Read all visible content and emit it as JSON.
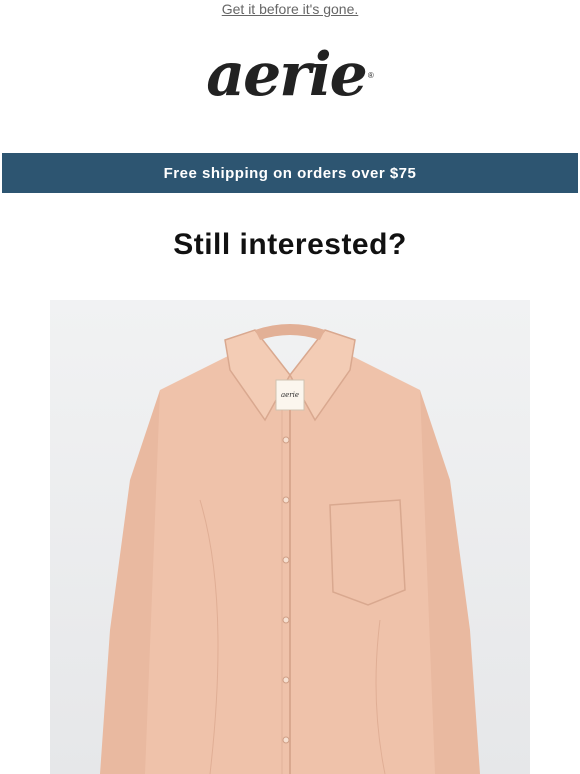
{
  "preheader": {
    "link_text": "Get it before it's gone."
  },
  "brand": {
    "logo_text": "aerie",
    "registered_mark": "®"
  },
  "shipping_bar": {
    "text": "Free shipping on orders over $75",
    "background": "#2d5571"
  },
  "headline": {
    "text": "Still interested?"
  },
  "product": {
    "image_icon": "shirt-icon",
    "shirt_color": "#efc2aa",
    "label_text": "aerie"
  }
}
